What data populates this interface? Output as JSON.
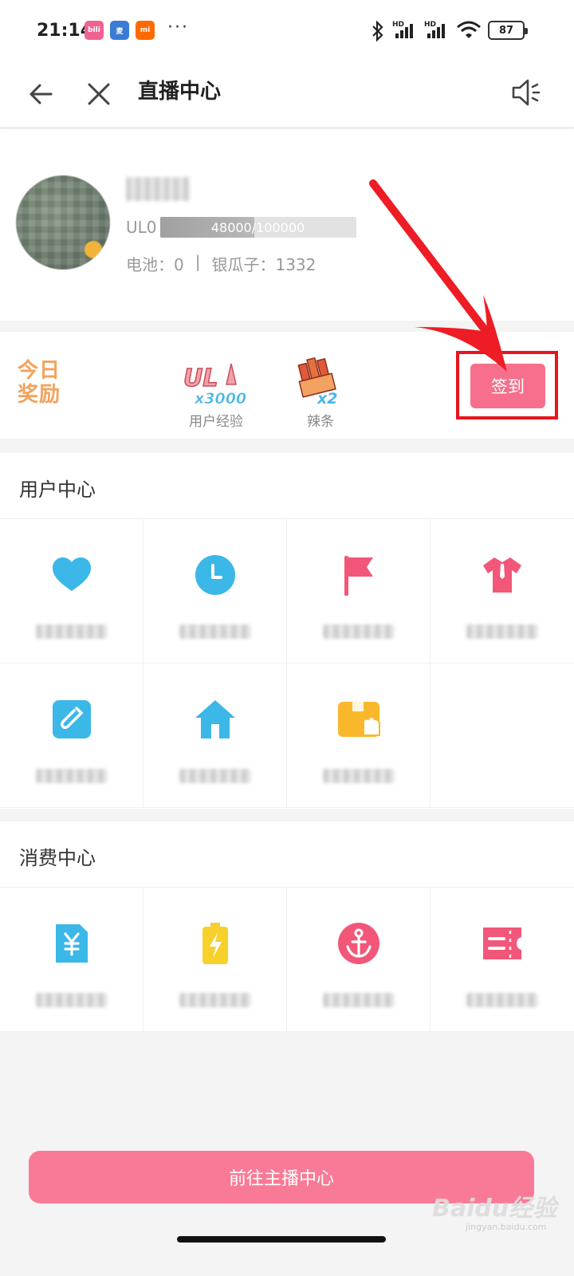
{
  "status_bar": {
    "time": "21:14",
    "apps": [
      {
        "name": "bilibili",
        "color": "#f06292",
        "text": "bili"
      },
      {
        "name": "麦",
        "color": "#3a7bd5",
        "text": "麦"
      },
      {
        "name": "mi",
        "color": "#ff6a00",
        "text": "mi"
      }
    ],
    "more": "···",
    "battery": "87"
  },
  "nav": {
    "title": "直播中心"
  },
  "profile": {
    "level_label": "UL0",
    "level_progress": "48000/100000",
    "level_fraction": 0.48,
    "battery_label": "电池：0",
    "separator": "|",
    "silver_label": "银瓜子：1332"
  },
  "reward": {
    "title": "今日奖励",
    "items": [
      {
        "label": "用户经验",
        "badge": "x3000"
      },
      {
        "label": "辣条",
        "badge": "x2"
      }
    ],
    "checkin": "签到"
  },
  "user_center": {
    "title": "用户中心",
    "items": [
      {
        "icon": "heart-icon",
        "color": "#3bb7e8"
      },
      {
        "icon": "clock-icon",
        "color": "#3bb7e8"
      },
      {
        "icon": "flag-icon",
        "color": "#f2577a"
      },
      {
        "icon": "shirt-icon",
        "color": "#f2577a"
      },
      {
        "icon": "edit-icon",
        "color": "#3bb7e8"
      },
      {
        "icon": "home-icon",
        "color": "#3bb7e8"
      },
      {
        "icon": "package-icon",
        "color": "#f9b82c"
      }
    ]
  },
  "consume_center": {
    "title": "消费中心",
    "items": [
      {
        "icon": "yuan-icon",
        "color": "#3bb7e8"
      },
      {
        "icon": "battery-charge-icon",
        "color": "#f8d02c"
      },
      {
        "icon": "anchor-icon",
        "color": "#f2577a"
      },
      {
        "icon": "ticket-icon",
        "color": "#f2577a"
      }
    ]
  },
  "bottom_button": "前往主播中心",
  "watermark": {
    "text": "Baidu经验",
    "sub": "jingyan.baidu.com"
  },
  "colors": {
    "accent": "#f76f8c",
    "highlight": "#e8151d",
    "blue": "#3bb7e8"
  }
}
